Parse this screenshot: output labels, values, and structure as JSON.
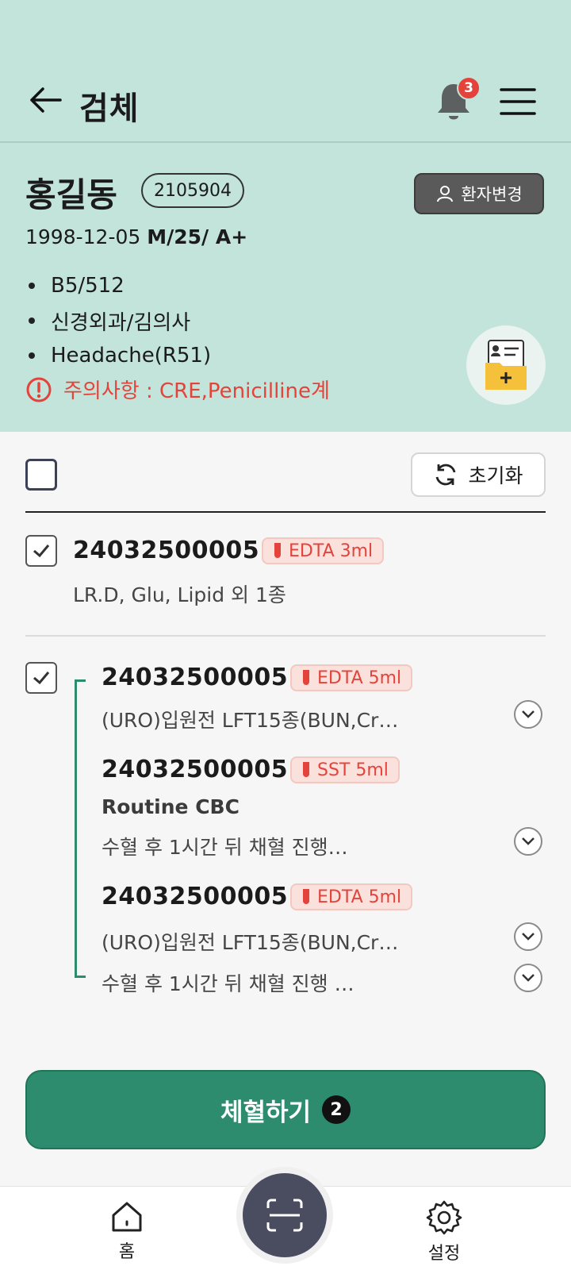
{
  "header": {
    "title": "검체",
    "notification_count": "3"
  },
  "patient": {
    "name": "홍길동",
    "id": "2105904",
    "change_label": "환자변경",
    "birth": "1998-12-05",
    "sex_age_blood": "M/25/ A+",
    "details": [
      "B5/512",
      "신경외과/김의사",
      "Headache(R51)"
    ],
    "warning": "주의사항 : CRE,Penicilline계"
  },
  "toolbar": {
    "reset_label": "초기화"
  },
  "specimens": [
    {
      "number": "24032500005",
      "tube": "EDTA 3ml",
      "tests": "LR.D, Glu, Lipid 외 1종",
      "checked": true
    }
  ],
  "group": {
    "checked": true,
    "items": [
      {
        "number": "24032500005",
        "tube": "EDTA 5ml",
        "lines": [
          "(URO)입원전 LFT15종(BUN,Cr…"
        ]
      },
      {
        "number": "24032500005",
        "tube": "SST 5ml",
        "title": "Routine CBC",
        "lines": [
          "수혈 후 1시간 뒤 채혈 진행…"
        ]
      },
      {
        "number": "24032500005",
        "tube": "EDTA 5ml",
        "lines": [
          "(URO)입원전 LFT15종(BUN,Cr…",
          "수혈 후 1시간 뒤 채혈 진행 …"
        ]
      }
    ]
  },
  "action": {
    "label": "체혈하기",
    "count": "2"
  },
  "nav": {
    "home_label": "홈",
    "settings_label": "설정"
  },
  "colors": {
    "header_bg": "#c2e4da",
    "primary": "#2e8c6e",
    "warning": "#e4433b",
    "tube_bg": "#fbe1dc"
  }
}
